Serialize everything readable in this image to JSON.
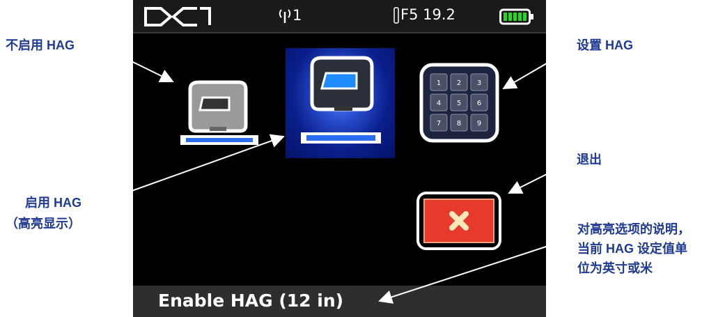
{
  "callouts": {
    "disable_hag": "不启用 HAG",
    "set_hag": "设置 HAG",
    "exit": "退出",
    "enable_hag_line1": "启用 HAG",
    "enable_hag_line2": "（高亮显示）",
    "description_line1": "对高亮选项的说明，",
    "description_line2": "当前 HAG 设定值单",
    "description_line3": "位为英寸或米"
  },
  "statusbar": {
    "logo": "DCI",
    "signal_icon": "antenna-icon",
    "signal_value": "1",
    "frequency_icon": "thermometer-icon",
    "frequency_label": "F5 19.2",
    "battery_icon": "battery-icon"
  },
  "menu": {
    "items": [
      {
        "name": "disable-hag-option",
        "icon": "receiver-icon"
      },
      {
        "name": "enable-hag-option",
        "icon": "receiver-icon",
        "selected": true
      },
      {
        "name": "set-hag-option",
        "icon": "keypad-icon"
      },
      {
        "name": "exit-option",
        "icon": "close-icon"
      }
    ],
    "keypad_digits": [
      "1",
      "2",
      "3",
      "4",
      "5",
      "6",
      "7",
      "8",
      "9"
    ]
  },
  "footer": {
    "status_text": "Enable HAG (12 in)"
  },
  "colors": {
    "callout_text": "#1f3a93",
    "highlight": "#0a1f8c",
    "accent_blue": "#2a6df0",
    "exit_red": "#e63a2a",
    "battery_green": "#1fdc1f"
  }
}
